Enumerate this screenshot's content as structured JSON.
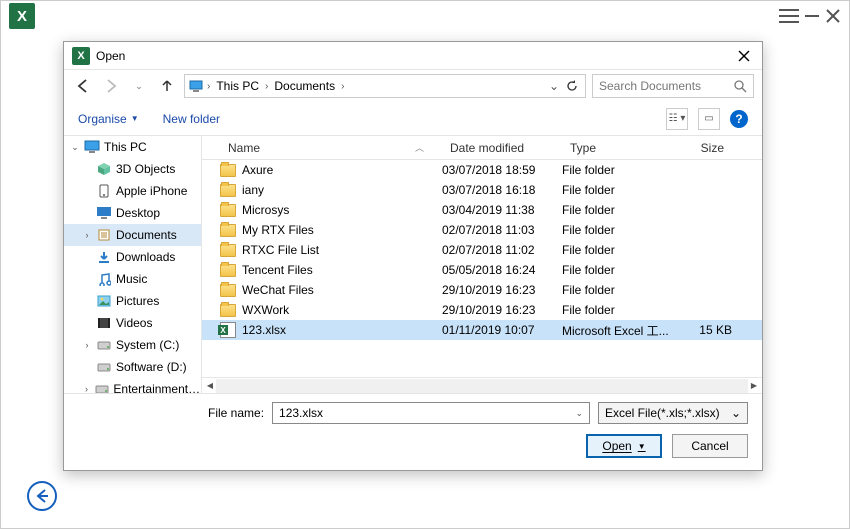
{
  "app": {
    "branding_letter": "X"
  },
  "dialog": {
    "title": "Open",
    "breadcrumb": [
      "This PC",
      "Documents"
    ],
    "search_placeholder": "Search Documents",
    "toolbar": {
      "organise": "Organise",
      "new_folder": "New folder"
    },
    "columns": {
      "name": "Name",
      "date": "Date modified",
      "type": "Type",
      "size": "Size"
    },
    "tree": [
      {
        "label": "This PC",
        "icon": "monitor",
        "chev": "v",
        "indent": 0
      },
      {
        "label": "3D Objects",
        "icon": "cube",
        "chev": "",
        "indent": 1
      },
      {
        "label": "Apple iPhone",
        "icon": "phone",
        "chev": "",
        "indent": 1
      },
      {
        "label": "Desktop",
        "icon": "desktop",
        "chev": "",
        "indent": 1
      },
      {
        "label": "Documents",
        "icon": "doc",
        "chev": ">",
        "indent": 1,
        "selected": true
      },
      {
        "label": "Downloads",
        "icon": "download",
        "chev": "",
        "indent": 1
      },
      {
        "label": "Music",
        "icon": "music",
        "chev": "",
        "indent": 1
      },
      {
        "label": "Pictures",
        "icon": "picture",
        "chev": "",
        "indent": 1
      },
      {
        "label": "Videos",
        "icon": "video",
        "chev": "",
        "indent": 1
      },
      {
        "label": "System (C:)",
        "icon": "drive",
        "chev": ">",
        "indent": 1
      },
      {
        "label": "Software (D:)",
        "icon": "drive",
        "chev": "",
        "indent": 1
      },
      {
        "label": "Entertainment (E:)",
        "icon": "drive",
        "chev": ">",
        "indent": 1
      }
    ],
    "rows": [
      {
        "name": "Axure",
        "date": "03/07/2018 18:59",
        "type": "File folder",
        "size": "",
        "icon": "folder"
      },
      {
        "name": "iany",
        "date": "03/07/2018 16:18",
        "type": "File folder",
        "size": "",
        "icon": "folder"
      },
      {
        "name": "Microsys",
        "date": "03/04/2019 11:38",
        "type": "File folder",
        "size": "",
        "icon": "folder"
      },
      {
        "name": "My RTX Files",
        "date": "02/07/2018 11:03",
        "type": "File folder",
        "size": "",
        "icon": "folder"
      },
      {
        "name": "RTXC File List",
        "date": "02/07/2018 11:02",
        "type": "File folder",
        "size": "",
        "icon": "folder"
      },
      {
        "name": "Tencent Files",
        "date": "05/05/2018 16:24",
        "type": "File folder",
        "size": "",
        "icon": "folder"
      },
      {
        "name": "WeChat Files",
        "date": "29/10/2019 16:23",
        "type": "File folder",
        "size": "",
        "icon": "folder"
      },
      {
        "name": "WXWork",
        "date": "29/10/2019 16:23",
        "type": "File folder",
        "size": "",
        "icon": "folder"
      },
      {
        "name": "123.xlsx",
        "date": "01/11/2019 10:07",
        "type": "Microsoft Excel 工...",
        "size": "15 KB",
        "icon": "xlsx",
        "selected": true
      }
    ],
    "filename_label": "File name:",
    "filename_value": "123.xlsx",
    "filter_value": "Excel File(*.xls;*.xlsx)",
    "open_btn": "Open",
    "cancel_btn": "Cancel"
  }
}
